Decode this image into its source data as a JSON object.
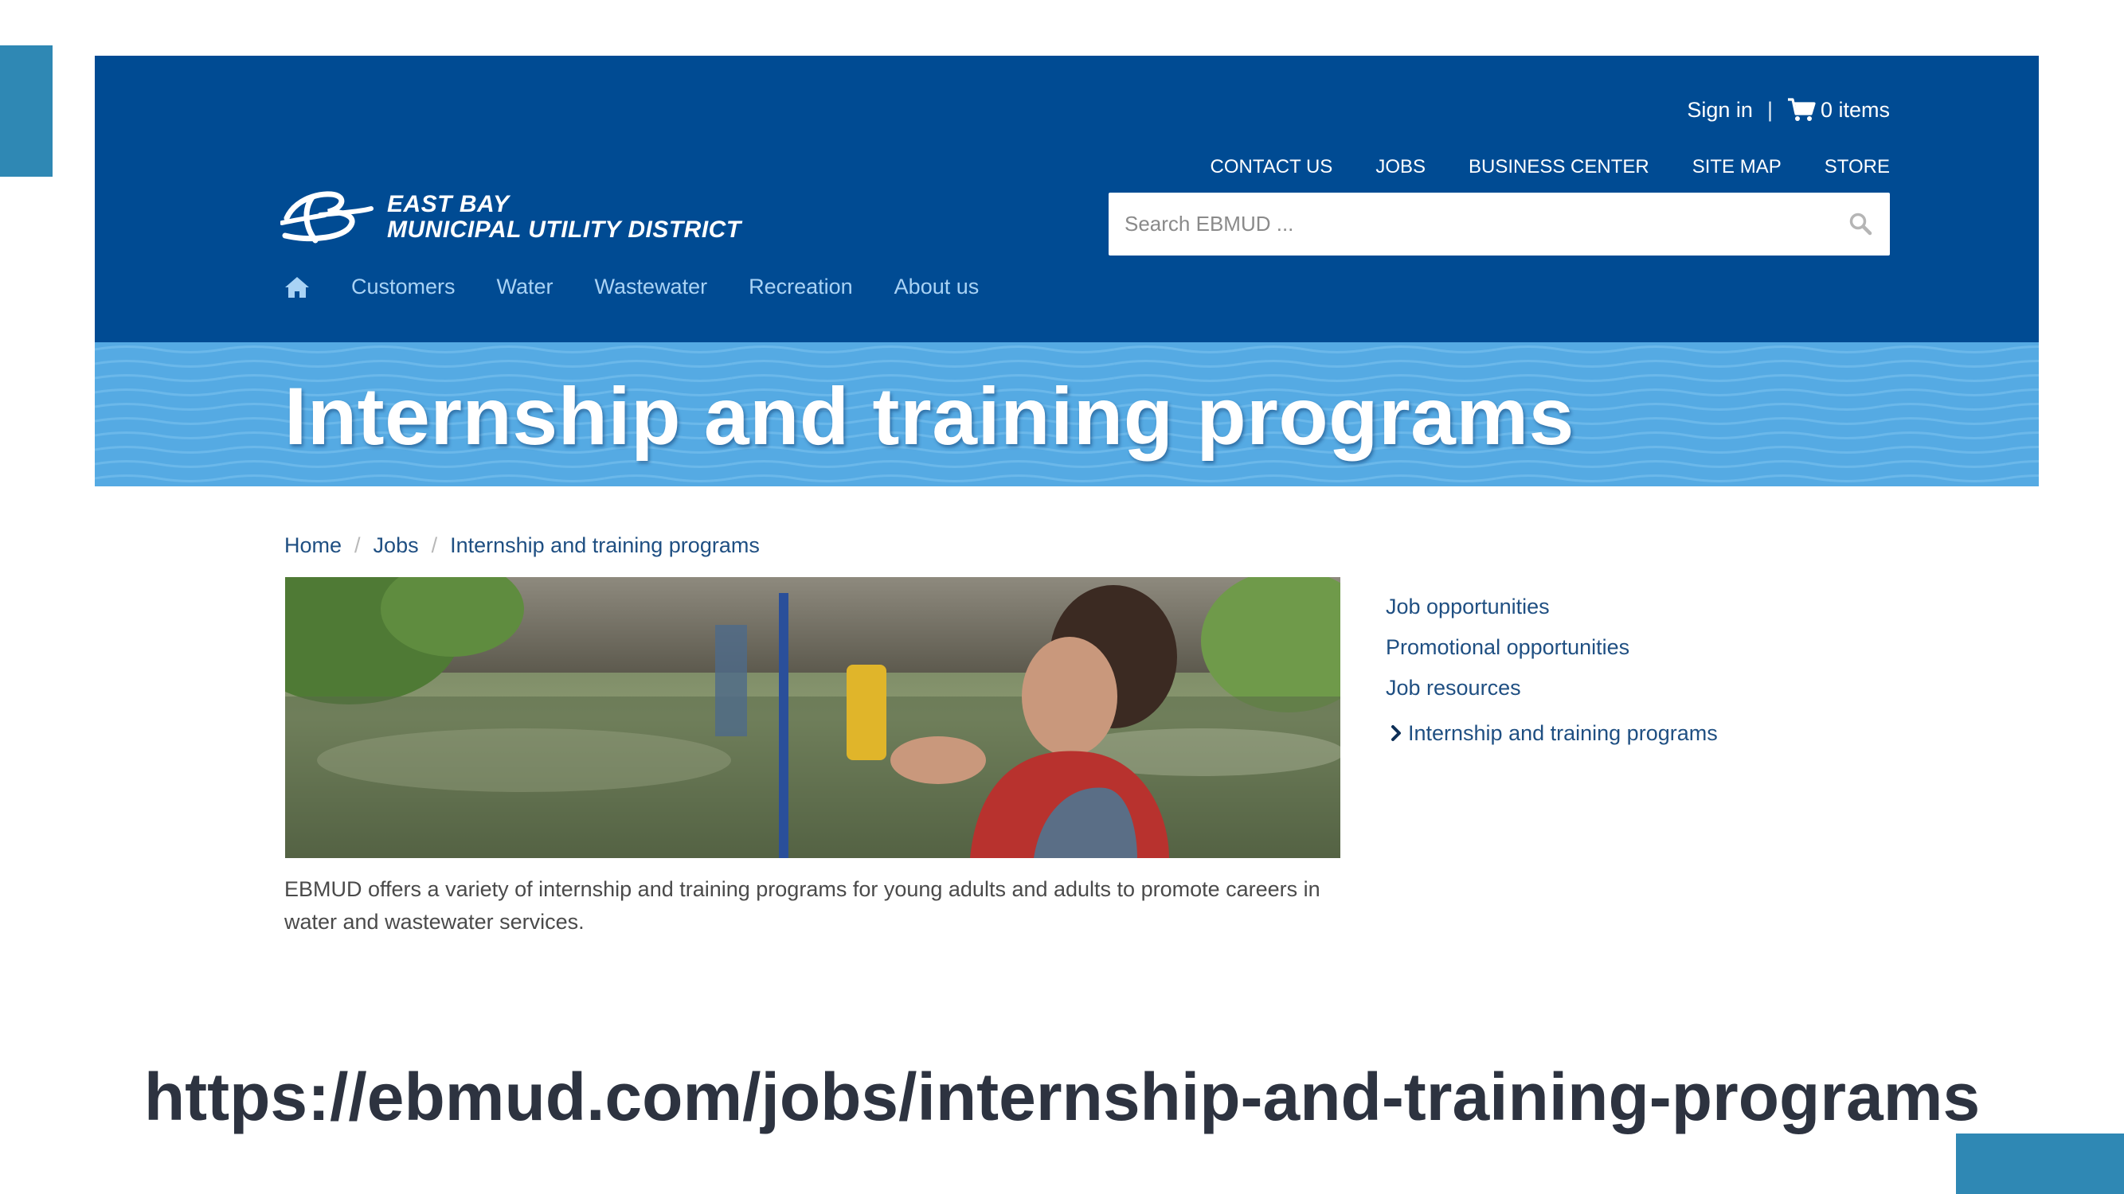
{
  "header": {
    "utility": {
      "sign_in": "Sign in",
      "separator": "|",
      "cart": "0 items"
    },
    "top_links": [
      "CONTACT US",
      "JOBS",
      "BUSINESS CENTER",
      "SITE MAP",
      "STORE"
    ],
    "logo": {
      "line1": "EAST BAY",
      "line2": "MUNICIPAL UTILITY DISTRICT"
    },
    "search": {
      "placeholder": "Search EBMUD ..."
    },
    "main_nav": [
      "Customers",
      "Water",
      "Wastewater",
      "Recreation",
      "About us"
    ]
  },
  "banner": {
    "title": "Internship and training programs"
  },
  "breadcrumb": [
    "Home",
    "Jobs",
    "Internship and training programs"
  ],
  "content": {
    "caption": "EBMUD offers a variety of internship and training programs for young adults and adults to promote careers in water and wastewater services."
  },
  "sidebar": {
    "items": [
      "Job opportunities",
      "Promotional opportunities",
      "Job resources",
      "Internship and training programs"
    ],
    "current_index": 3
  },
  "url": "https://ebmud.com/jobs/internship-and-training-programs",
  "colors": {
    "header": "#004b93",
    "banner": "#55aae3",
    "accent": "#2f88b4",
    "link": "#1f4f82"
  },
  "icons": [
    "cart-icon",
    "search-icon",
    "home-icon",
    "chevron-right-icon",
    "ebmud-logo"
  ]
}
